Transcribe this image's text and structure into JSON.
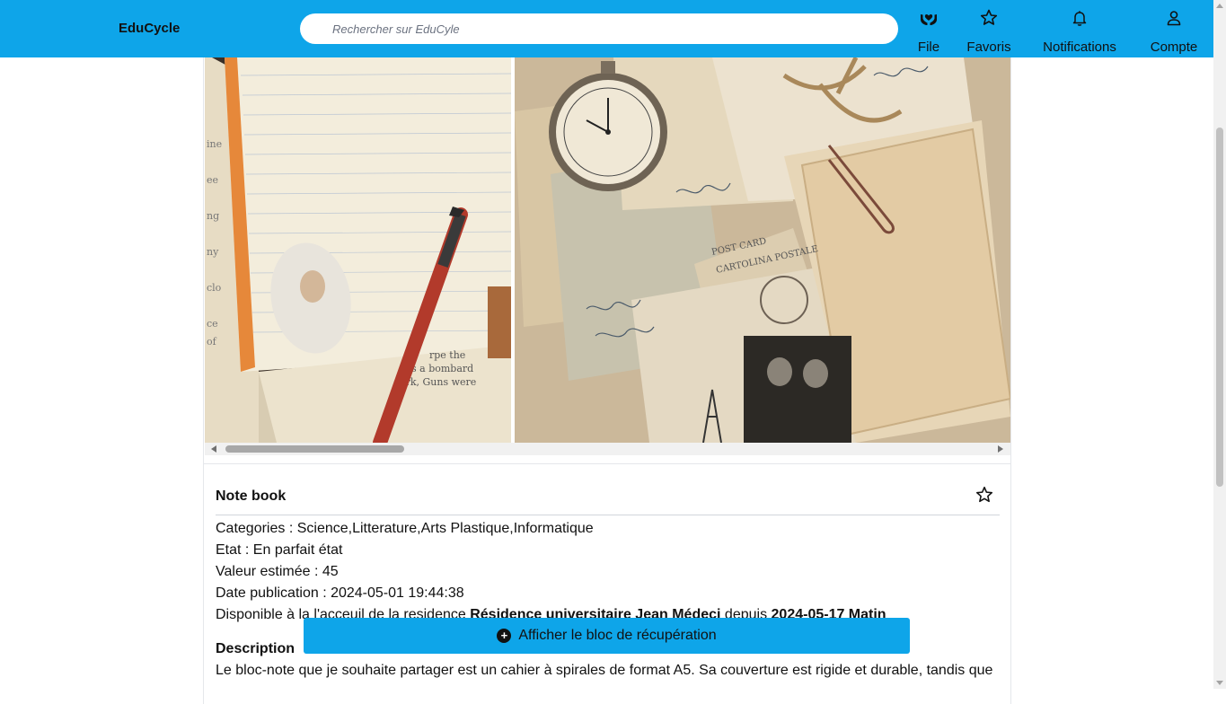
{
  "header": {
    "brand": "EduCycle",
    "search_placeholder": "Rechercher sur EduCyle",
    "nav": {
      "file": "File",
      "favoris": "Favoris",
      "notifications": "Notifications",
      "compte": "Compte"
    }
  },
  "item": {
    "title": "Note book",
    "categories_label": "Categories : ",
    "categories": "Science,Litterature,Arts Plastique,Informatique",
    "etat_label": "Etat : ",
    "etat": "En parfait état",
    "valeur_label": "Valeur estimée : ",
    "valeur": "45",
    "date_label": "Date publication : ",
    "date": "2024-05-01 19:44:38",
    "dispo_prefix": "Disponible à la l'acceuil de la residence ",
    "residence": "Résidence universitaire Jean Médeci",
    "dispo_mid": " depuis ",
    "dispo_date": "2024-05-17 Matin",
    "description_title": "Description",
    "description": "Le bloc-note que je souhaite partager est un cahier à spirales de format A5. Sa couverture est rigide et durable, tandis que"
  },
  "cta": {
    "label": "Afficher le bloc de récupération"
  },
  "icons": {
    "file": "hands-heart-icon",
    "favoris": "star-icon",
    "notifications": "bell-icon",
    "compte": "user-icon"
  },
  "colors": {
    "accent": "#0ea5e9"
  }
}
